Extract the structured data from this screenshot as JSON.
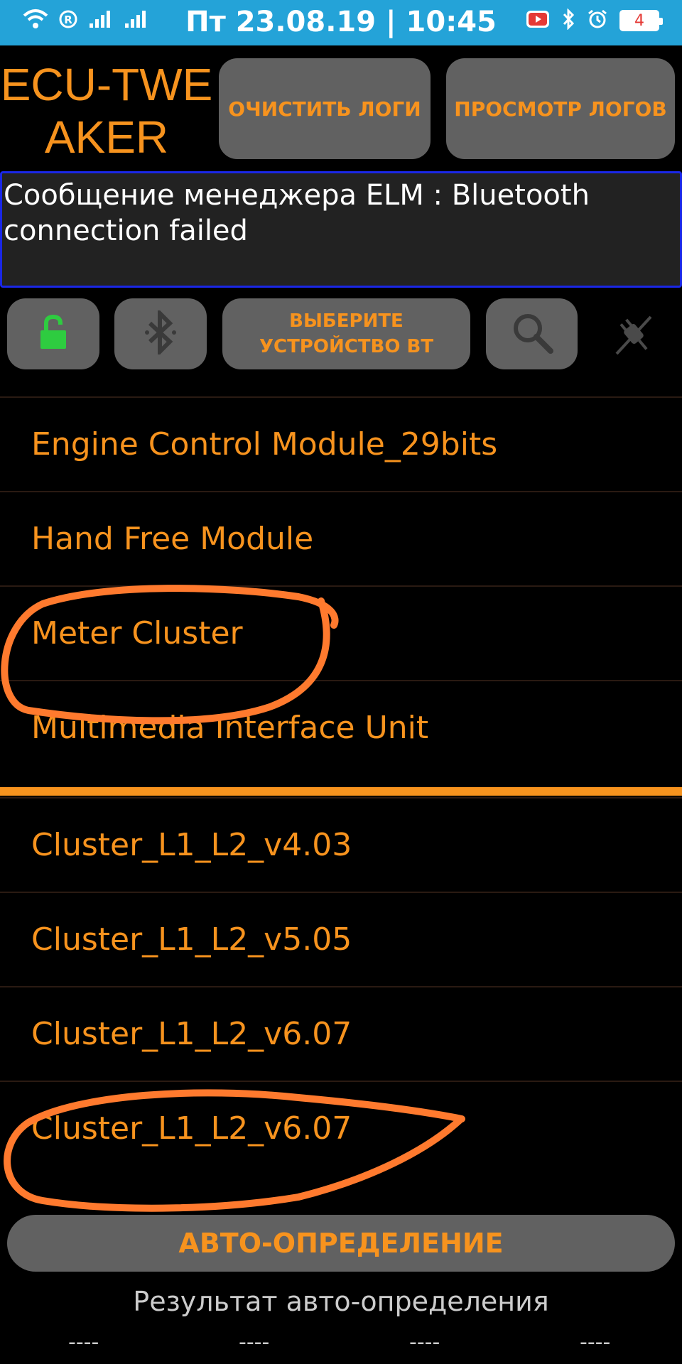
{
  "status_bar": {
    "datetime": "Пт 23.08.19 | 10:45",
    "battery": "4",
    "icons": [
      "wifi-icon",
      "registered-icon",
      "signal-icon",
      "signal-icon",
      "youtube-icon",
      "bluetooth-icon",
      "alarm-icon",
      "battery-icon"
    ]
  },
  "header": {
    "title_line1": "ECU-TWE",
    "title_line2": "AKER",
    "clear_logs": "ОЧИСТИТЬ ЛОГИ",
    "view_logs": "ПРОСМОТР ЛОГОВ"
  },
  "message": {
    "text": "Сообщение менеджера ELM : Bluetooth connection failed"
  },
  "toolbar": {
    "select_device_line1": "ВЫБЕРИТЕ",
    "select_device_line2": "УСТРОЙСТВО ВТ",
    "icons": [
      "unlock-icon",
      "bluetooth-icon",
      "search-icon",
      "plug-icon"
    ]
  },
  "modules": [
    "Engine Control Module_29bits",
    "Hand Free Module",
    "Meter Cluster",
    "Multimedia Interface Unit"
  ],
  "versions": [
    "Cluster_L1_L2_v4.03",
    "Cluster_L1_L2_v5.05",
    "Cluster_L1_L2_v6.07",
    "Cluster_L1_L2_v6.07"
  ],
  "footer": {
    "auto_detect": "АВТО-ОПРЕДЕЛЕНИЕ",
    "result_label": "Результат авто-определения",
    "results": [
      "----",
      "----",
      "----",
      "----"
    ]
  },
  "colors": {
    "accent": "#f7931e",
    "status_bar": "#24a3d8",
    "button": "#616161",
    "message_border": "#1a27e6",
    "annotation": "#ff7a2e",
    "unlock_green": "#2ecc40"
  }
}
